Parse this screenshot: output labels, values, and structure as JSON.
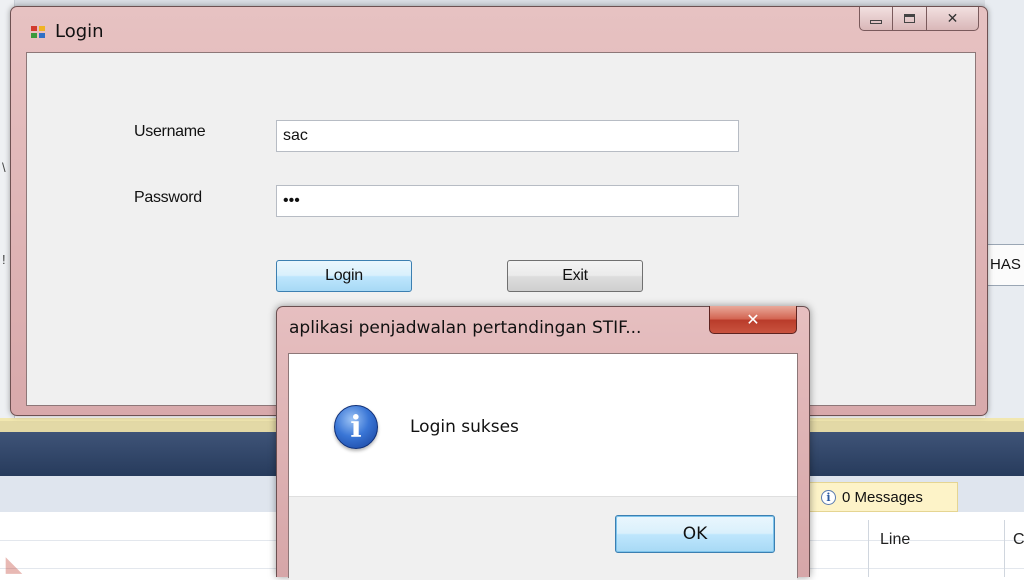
{
  "login_window": {
    "title": "Login",
    "username_label": "Username",
    "username_value": "sac",
    "password_label": "Password",
    "password_value": "•••",
    "login_button": "Login",
    "exit_button": "Exit",
    "caption_close": "✕"
  },
  "message_box": {
    "title": "aplikasi penjadwalan pertandingan STIF...",
    "close_glyph": "✕",
    "message": "Login sukses",
    "ok_button": "OK"
  },
  "background": {
    "right_edge_text": "HAS",
    "messages_badge": "0 Messages",
    "column_line": "Line",
    "column_cut": "C"
  },
  "colors": {
    "window_frame": "#d8a9ab",
    "client_bg": "#f0f0f0",
    "ide_header": "#273b5c",
    "badge_bg": "#fdf3c8",
    "focus_button": "#bee6fd"
  },
  "icons": [
    "app-form-icon",
    "info-icon",
    "close-icon",
    "minimize-icon",
    "maximize-icon"
  ]
}
